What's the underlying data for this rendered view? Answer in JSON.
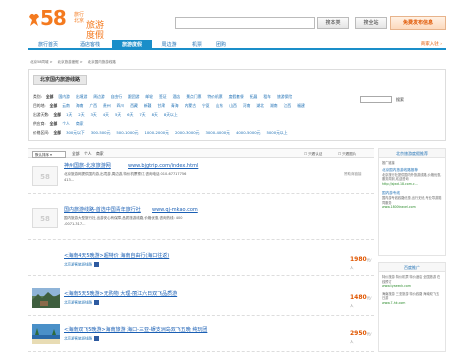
{
  "header": {
    "logo_number": "58",
    "logo_sub": "旅行",
    "logo_city": "北京",
    "logo_title": "旅游度假",
    "search_placeholder": "",
    "search_button": "搜本类",
    "search_all_button": "搜全站",
    "post_button": "免费发布信息"
  },
  "nav": {
    "tabs": [
      {
        "label": "旅行首页",
        "active": false
      },
      {
        "label": "酒店客栈",
        "active": false
      },
      {
        "label": "旅游度假",
        "active": true
      },
      {
        "label": "周边游",
        "active": false
      },
      {
        "label": "机票",
        "active": false
      },
      {
        "label": "团购",
        "active": false
      }
    ],
    "right_link": "商家入驻 ›"
  },
  "breadcrumb": [
    "北京58同城 >",
    "北京旅游度假 >",
    "北京国内旅游线路"
  ],
  "filters": {
    "title": "北京国内旅游线路",
    "rows": [
      {
        "label": "类别:",
        "selected": "全部",
        "options": [
          "国内游",
          "出境游",
          "周边游",
          "自由行",
          "跟团游",
          "邮轮",
          "签证",
          "酒店",
          "景点门票",
          "特价机票",
          "度假套餐",
          "拓展",
          "租车",
          "旅游保险"
        ]
      },
      {
        "label": "目的地:",
        "selected": "全部",
        "options": [
          "云南",
          "海南",
          "广西",
          "贵州",
          "四川",
          "西藏",
          "新疆",
          "甘肃",
          "青海",
          "内蒙古",
          "宁夏",
          "山东",
          "山西",
          "河南",
          "湖北",
          "湖南",
          "江西",
          "福建"
        ]
      },
      {
        "label": "出游天数:",
        "selected": "全部",
        "options": [
          "1天",
          "2天",
          "3天",
          "4天",
          "5天",
          "6天",
          "7天",
          "8天",
          "8天以上"
        ]
      },
      {
        "label": "供应商:",
        "selected": "全部",
        "options": [
          "个人",
          "商家"
        ]
      },
      {
        "label": "价格区间:",
        "selected": "全部",
        "options": [
          "300元以下",
          "300-500元",
          "500-1000元",
          "1000-2000元",
          "2000-3000元",
          "3000-4000元",
          "4000-5000元",
          "5000元以上"
        ]
      }
    ],
    "search_button": "搜索"
  },
  "sortbar": {
    "select_label": "默认排序 ▾",
    "link_all": "全部",
    "link_personal": "个人",
    "link_merchant": "商家",
    "right_items": [
      "☐ 只看认证",
      "☐ 只看图片"
    ]
  },
  "listings": [
    {
      "kind": "ad",
      "placeholder": "58",
      "title": "神州国旅-北京旅游网",
      "url": "www.bjgtrip.com/index.html",
      "desc1": "北京旅游网提供国内游,出境游,周边游,特价机票预订,咨询电话 010-67717756",
      "desc2": "413...",
      "tag": "赞助商链接"
    },
    {
      "kind": "ad",
      "placeholder": "58",
      "title": "国内旅游线路-首选中国青年旅行社",
      "url": "www.qj-mkao.com",
      "desc1": "国内旅游大型旅行社,出游安心有保障,品质旅游线路,价格优惠,咨询热线: 400",
      "desc2": "-0071-317...",
      "tag": ""
    },
    {
      "kind": "item",
      "title": "<海南4天5晚游>超特价 海南自由行(海口往返)",
      "sub": "北京游客旅游线路",
      "price": "1980",
      "unit": "元/人",
      "has_photo": false
    },
    {
      "kind": "item",
      "title": "<海南5天5晚游>无购物 大理-丽江六日双飞品质游",
      "sub": "北京游客旅游线路",
      "price": "1480",
      "unit": "元/人",
      "has_photo": true
    },
    {
      "kind": "item",
      "title": "<海南双飞5晚游>海南旅游 海口-三亚-蜈支洲岛双飞五晚 纯玩团",
      "sub": "北京游客旅游线路",
      "price": "2950",
      "unit": "元/人",
      "has_photo": true
    }
  ],
  "sidebar": {
    "top_head": "北京旅游度假推荐",
    "ads_label": "推广链接",
    "ads": [
      {
        "title": "北京国内旅游线路推荐",
        "text": "北京旅行社提供国内外旅游线路,价格优惠,服务周到,欢迎咨询",
        "url": "http://sjwd.18.com.c..."
      },
      {
        "title": "国内游专线",
        "text": "国内游专线线路优惠,出行无忧,专业导游陪同服务",
        "url": "www.1800travel.com"
      }
    ],
    "bottom_head": "百度推广",
    "bottom_ads": [
      {
        "text": "特价旅游 特价机票 特价酒店 全国旅游 在线预订",
        "url": "www.tyaeeck.com"
      },
      {
        "text": "海南旅游 三亚旅游 特价线路 海南双飞五日游",
        "url": "www.7-hk.com"
      }
    ]
  },
  "colors": {
    "brand_orange": "#f47a1f",
    "nav_blue": "#1a8ec9",
    "link_blue": "#1a5fb4",
    "price_orange": "#e05600"
  }
}
